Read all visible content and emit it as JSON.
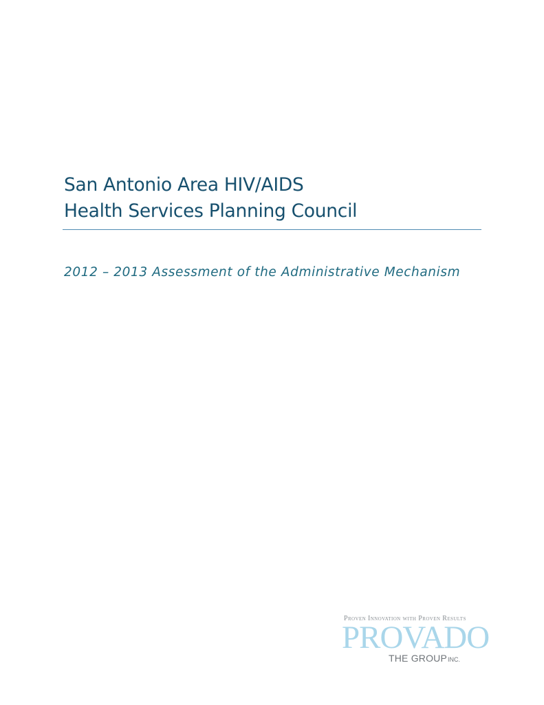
{
  "document": {
    "title_line1": "San Antonio Area HIV/AIDS",
    "title_line2": "Health Services Planning Council",
    "subtitle": "2012 – 2013 Assessment of the Administrative Mechanism"
  },
  "logo": {
    "tagline": "Proven Innovation with Proven Results",
    "wordmark": "PROVADO",
    "group": "THE GROUP",
    "inc": "INC.",
    "colors": {
      "wordmark": "#a9d6ea",
      "text": "#6f7479"
    }
  },
  "colors": {
    "title": "#17506e",
    "rule": "#4f8cb3",
    "subtitle": "#1f6a80"
  }
}
